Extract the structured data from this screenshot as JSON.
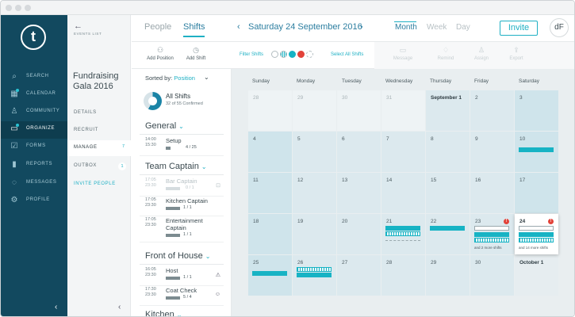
{
  "nav": {
    "logo": "t",
    "items": [
      {
        "label": "Search",
        "icon": "search-icon"
      },
      {
        "label": "Calendar",
        "icon": "calendar-icon"
      },
      {
        "label": "Community",
        "icon": "person-icon"
      },
      {
        "label": "Organize",
        "icon": "folder-icon"
      },
      {
        "label": "Forms",
        "icon": "checkbox-icon"
      },
      {
        "label": "Reports",
        "icon": "bar-chart-icon"
      },
      {
        "label": "Messages",
        "icon": "chat-icon"
      },
      {
        "label": "Profile",
        "icon": "gear-icon"
      }
    ],
    "collapse_glyph": "‹"
  },
  "events": {
    "back_glyph": "←",
    "list_label": "Events List",
    "event_name": "Fundraising Gala 2016",
    "items": [
      {
        "label": "Details",
        "count": ""
      },
      {
        "label": "Recruit",
        "count": ""
      },
      {
        "label": "Manage",
        "count": "7"
      },
      {
        "label": "Outbox",
        "count": "1"
      },
      {
        "label": "Invite People",
        "count": ""
      }
    ],
    "collapse_glyph": "‹"
  },
  "topbar": {
    "tabs": [
      "People",
      "Shifts"
    ],
    "prev_glyph": "‹",
    "next_glyph": "›",
    "date_title": "Saturday 24 September 2016",
    "views": [
      "Month",
      "Week",
      "Day"
    ],
    "invite_label": "Invite",
    "avatar_initials": "dF"
  },
  "toolbar": {
    "add_position": "Add Position",
    "add_shift": "Add Shift",
    "filter_label": "Filter Shifts",
    "select_all": "Select All Shifts",
    "actions": [
      "Message",
      "Remind",
      "Assign",
      "Export"
    ]
  },
  "shifts": {
    "sort_label": "Sorted by:",
    "sort_value": "Position",
    "all_title": "All Shifts",
    "all_sub": "32 of 55 Confirmed",
    "groups": [
      {
        "name": "General"
      },
      {
        "name": "Team Captain"
      },
      {
        "name": "Front of House"
      },
      {
        "name": "Kitchen"
      }
    ],
    "rows": [
      {
        "start": "14:00",
        "end": "15:30",
        "title": "Setup",
        "count": "4 / 25",
        "fill": 0.16
      },
      {
        "start": "17:05",
        "end": "23:30",
        "title": "Bar Captain",
        "count": "0 / 1",
        "fill": 0
      },
      {
        "start": "17:05",
        "end": "23:30",
        "title": "Kitchen Captain",
        "count": "1 / 1",
        "fill": 1
      },
      {
        "start": "17:05",
        "end": "23:30",
        "title": "Entertainment Captain",
        "count": "1 / 1",
        "fill": 1
      },
      {
        "start": "16:05",
        "end": "23:30",
        "title": "Host",
        "count": "1 / 1",
        "fill": 1
      },
      {
        "start": "17:30",
        "end": "23:30",
        "title": "Coat Check",
        "count": "5 / 4",
        "fill": 1
      }
    ]
  },
  "calendar": {
    "weekdays": [
      "Sunday",
      "Monday",
      "Tuesday",
      "Wednesday",
      "Thursday",
      "Friday",
      "Saturday"
    ],
    "days": [
      "28",
      "29",
      "30",
      "31",
      "September 1",
      "2",
      "3",
      "4",
      "5",
      "6",
      "7",
      "8",
      "9",
      "10",
      "11",
      "12",
      "13",
      "14",
      "15",
      "16",
      "17",
      "18",
      "19",
      "20",
      "21",
      "22",
      "23",
      "24",
      "25",
      "26",
      "27",
      "28",
      "29",
      "30",
      "October 1"
    ],
    "more_23": "and 2 more shifts",
    "more_24": "and 14 more shifts",
    "badge": "!"
  },
  "colors": {
    "nav_bg": "#12495f",
    "accent": "#1fb0c4",
    "alert": "#e2433a"
  }
}
